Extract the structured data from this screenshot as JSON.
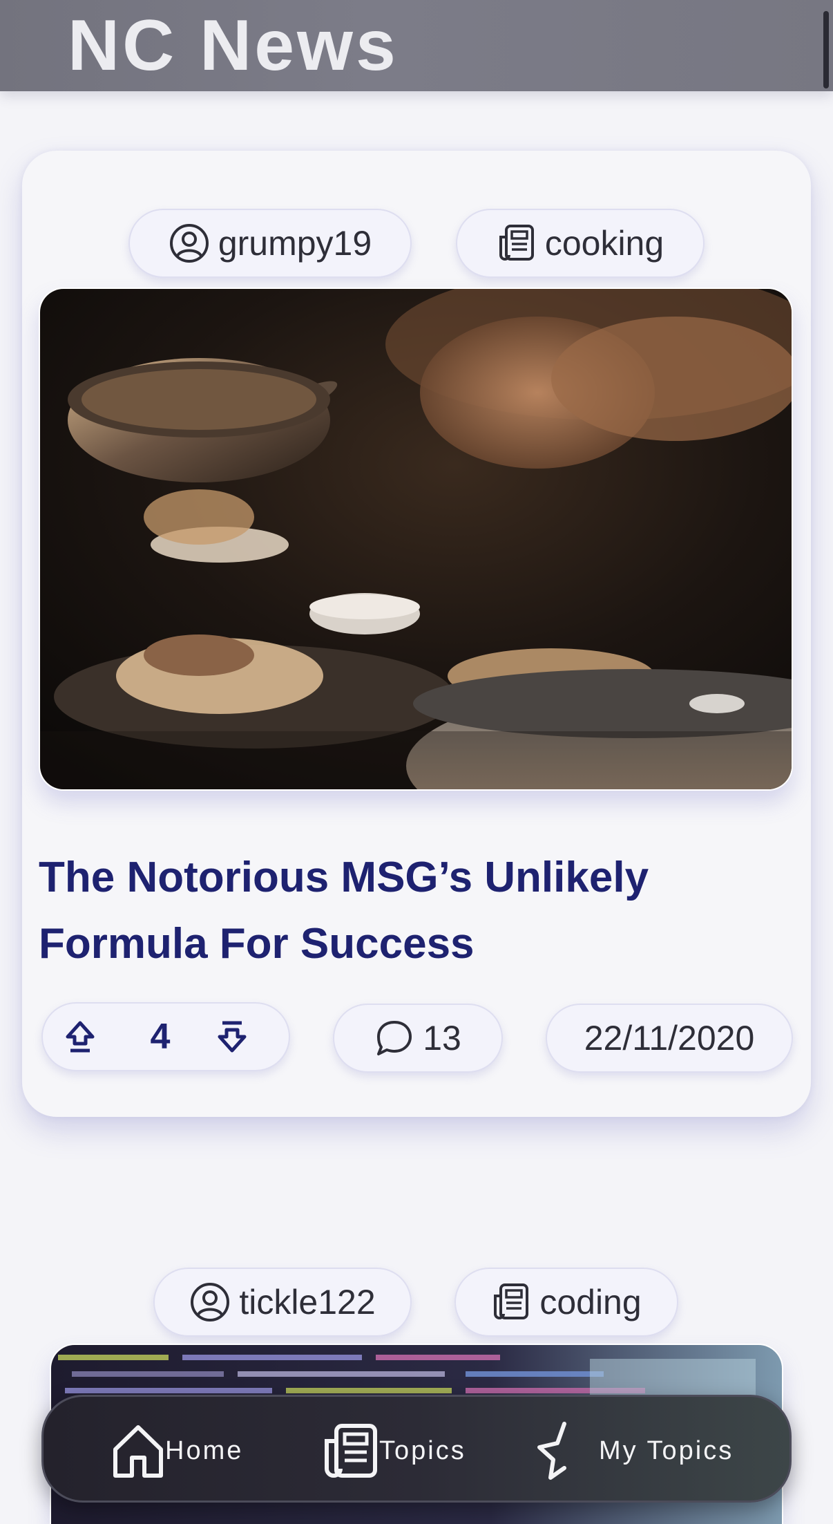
{
  "header": {
    "title": "NC News"
  },
  "articles": [
    {
      "author": "grumpy19",
      "topic": "cooking",
      "title": "The Notorious MSG’s Unlikely Formula For Success",
      "votes": "4",
      "comment_count": "13",
      "date": "22/11/2020"
    },
    {
      "author": "tickle122",
      "topic": "coding"
    }
  ],
  "icons": {
    "author": "user-circle-icon",
    "topic": "newspaper-icon",
    "upvote": "arrow-up-icon",
    "downvote": "arrow-down-icon",
    "comments": "speech-bubble-icon",
    "home": "home-icon",
    "topics": "newspaper-icon",
    "my_topics": "star-icon"
  },
  "nav": {
    "home_label": "Home",
    "topics_label": "Topics",
    "my_topics_label": "My Topics"
  },
  "colors": {
    "accent": "#1e2270",
    "header_bg": "#777782",
    "page_bg": "#f4f4f8",
    "navbar_bg": "#2c2b36"
  }
}
